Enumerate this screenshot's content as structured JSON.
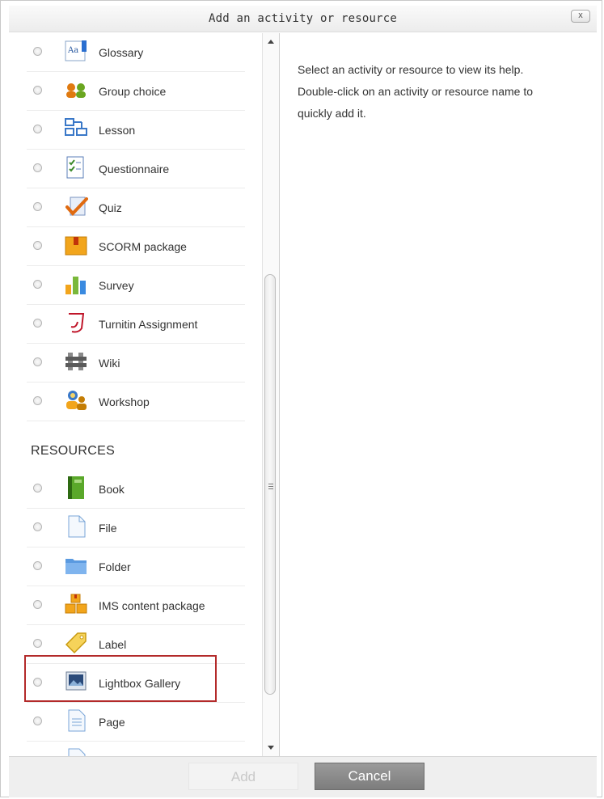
{
  "dialog": {
    "title": "Add an activity or resource",
    "close_label": "x"
  },
  "activities": [
    {
      "label": "Glossary",
      "icon": "glossary-icon"
    },
    {
      "label": "Group choice",
      "icon": "group-choice-icon"
    },
    {
      "label": "Lesson",
      "icon": "lesson-icon"
    },
    {
      "label": "Questionnaire",
      "icon": "questionnaire-icon"
    },
    {
      "label": "Quiz",
      "icon": "quiz-icon"
    },
    {
      "label": "SCORM package",
      "icon": "scorm-package-icon"
    },
    {
      "label": "Survey",
      "icon": "survey-icon"
    },
    {
      "label": "Turnitin Assignment",
      "icon": "turnitin-icon"
    },
    {
      "label": "Wiki",
      "icon": "wiki-icon"
    },
    {
      "label": "Workshop",
      "icon": "workshop-icon"
    }
  ],
  "resources_heading": "RESOURCES",
  "resources": [
    {
      "label": "Book",
      "icon": "book-icon"
    },
    {
      "label": "File",
      "icon": "file-icon"
    },
    {
      "label": "Folder",
      "icon": "folder-icon"
    },
    {
      "label": "IMS content package",
      "icon": "ims-package-icon"
    },
    {
      "label": "Label",
      "icon": "label-tag-icon"
    },
    {
      "label": "Lightbox Gallery",
      "icon": "lightbox-gallery-icon"
    },
    {
      "label": "Page",
      "icon": "page-icon"
    }
  ],
  "help": {
    "line1": "Select an activity or resource to view its help.",
    "line2": "Double-click on an activity or resource name to",
    "line3": "quickly add it."
  },
  "footer": {
    "add_label": "Add",
    "cancel_label": "Cancel"
  },
  "colors": {
    "highlight_border": "#b32a2a",
    "cancel_bg": "#8a8a8a"
  }
}
